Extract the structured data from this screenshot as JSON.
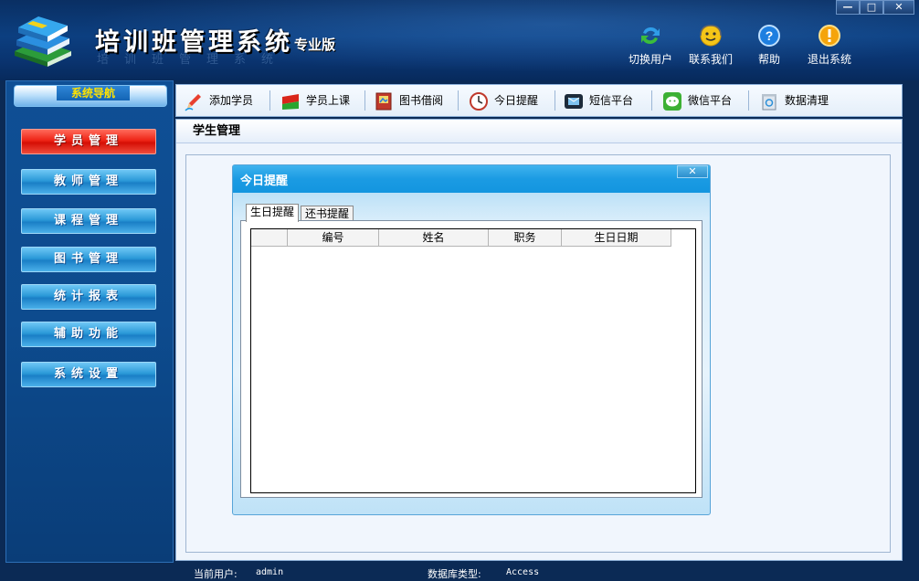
{
  "app": {
    "title": "培训班管理系统",
    "title_shadow": "培训班管理系统",
    "edition": "专业版"
  },
  "window_controls": {
    "minimize": "—",
    "maximize": "□",
    "close": "✕"
  },
  "top_tools": [
    {
      "label": "切换用户",
      "icon": "switch-user-icon"
    },
    {
      "label": "联系我们",
      "icon": "contact-icon"
    },
    {
      "label": "帮助",
      "icon": "help-icon"
    },
    {
      "label": "退出系统",
      "icon": "exit-icon"
    }
  ],
  "nav": {
    "header": "系统导航",
    "items": [
      {
        "label": "学员管理",
        "active": true
      },
      {
        "label": "教师管理",
        "active": false
      },
      {
        "label": "课程管理",
        "active": false
      },
      {
        "label": "图书管理",
        "active": false
      },
      {
        "label": "统计报表",
        "active": false
      },
      {
        "label": "辅助功能",
        "active": false
      },
      {
        "label": "系统设置",
        "active": false
      }
    ]
  },
  "toolbar": {
    "items": [
      {
        "label": "添加学员",
        "icon": "pen-icon"
      },
      {
        "label": "学员上课",
        "icon": "flag-icon"
      },
      {
        "label": "图书借阅",
        "icon": "book-icon"
      },
      {
        "label": "今日提醒",
        "icon": "clock-icon"
      },
      {
        "label": "短信平台",
        "icon": "sms-icon"
      },
      {
        "label": "微信平台",
        "icon": "wechat-icon"
      },
      {
        "label": "数据清理",
        "icon": "trash-icon"
      }
    ]
  },
  "main": {
    "title": "学生管理"
  },
  "dialog": {
    "title": "今日提醒",
    "close": "✕",
    "tabs": [
      "生日提醒",
      "还书提醒"
    ],
    "active_tab": "生日提醒",
    "columns": [
      "编号",
      "姓名",
      "职务",
      "生日日期"
    ],
    "rows": []
  },
  "status": {
    "user_label": "当前用户:",
    "user_value": "admin",
    "db_label": "数据库类型:",
    "db_value": "Access"
  },
  "colors": {
    "frame_blue": "#0b2a55",
    "nav_active": "#e8241a",
    "nav_button": "#2b9ad8",
    "dialog_title": "#1b9be3"
  }
}
